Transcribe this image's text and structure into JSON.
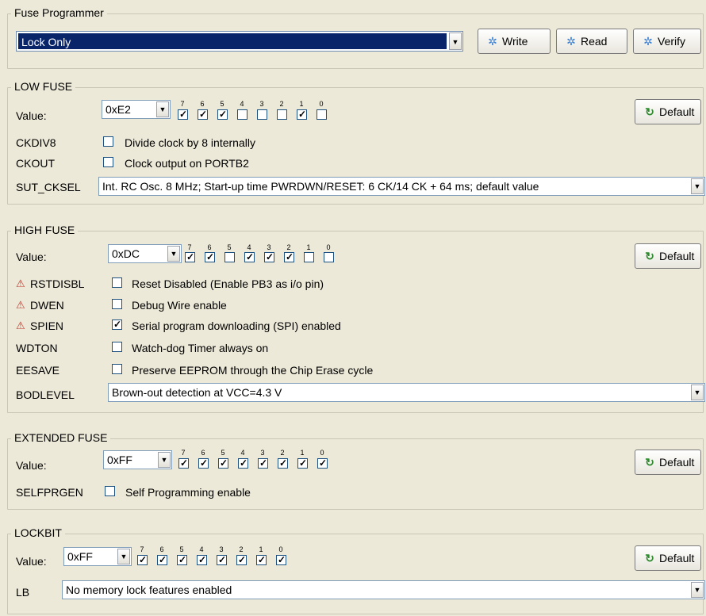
{
  "programmer": {
    "title": "Fuse Programmer",
    "mode_value": "Lock Only",
    "write_label": "Write",
    "read_label": "Read",
    "verify_label": "Verify"
  },
  "bit_labels": [
    "7",
    "6",
    "5",
    "4",
    "3",
    "2",
    "1",
    "0"
  ],
  "default_label": "Default",
  "value_label": "Value:",
  "icons": {
    "action": "sparkle-icon",
    "default": "refresh-icon",
    "warning": "warning-icon"
  },
  "low_fuse": {
    "title": "LOW FUSE",
    "value": "0xE2",
    "bits": [
      true,
      true,
      true,
      false,
      false,
      false,
      true,
      false
    ],
    "options": [
      {
        "name": "CKDIV8",
        "checked": false,
        "desc": "Divide clock by 8 internally"
      },
      {
        "name": "CKOUT",
        "checked": false,
        "desc": "Clock output on PORTB2"
      }
    ],
    "sut_cksel_label": "SUT_CKSEL",
    "sut_cksel_value": "Int. RC Osc. 8 MHz; Start-up time PWRDWN/RESET: 6 CK/14 CK + 64 ms; default value"
  },
  "high_fuse": {
    "title": "HIGH FUSE",
    "value": "0xDC",
    "bits": [
      true,
      true,
      false,
      true,
      true,
      true,
      false,
      false
    ],
    "options": [
      {
        "name": "RSTDISBL",
        "checked": false,
        "warn": true,
        "desc": "Reset Disabled (Enable PB3 as i/o pin)"
      },
      {
        "name": "DWEN",
        "checked": false,
        "warn": true,
        "desc": "Debug Wire enable"
      },
      {
        "name": "SPIEN",
        "checked": true,
        "warn": true,
        "desc": "Serial program downloading (SPI) enabled"
      },
      {
        "name": "WDTON",
        "checked": false,
        "warn": false,
        "desc": "Watch-dog Timer always on"
      },
      {
        "name": "EESAVE",
        "checked": false,
        "warn": false,
        "desc": "Preserve EEPROM through the Chip Erase cycle"
      }
    ],
    "bodlevel_label": "BODLEVEL",
    "bodlevel_value": "Brown-out detection at VCC=4.3 V"
  },
  "extended_fuse": {
    "title": "EXTENDED FUSE",
    "value": "0xFF",
    "bits": [
      true,
      true,
      true,
      true,
      true,
      true,
      true,
      true
    ],
    "options": [
      {
        "name": "SELFPRGEN",
        "checked": false,
        "desc": "Self Programming enable"
      }
    ]
  },
  "lockbit": {
    "title": "LOCKBIT",
    "value": "0xFF",
    "bits": [
      true,
      true,
      true,
      true,
      true,
      true,
      true,
      true
    ],
    "lb_label": "LB",
    "lb_value": "No memory lock features enabled"
  }
}
